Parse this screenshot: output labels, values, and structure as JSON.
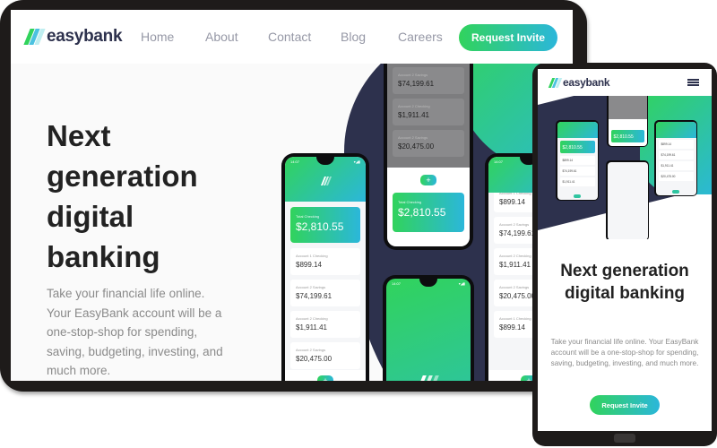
{
  "brand": {
    "name": "easybank",
    "colors": {
      "green": "#31d35c",
      "cyan": "#2bb7da",
      "navy": "#2d314d",
      "text_gray": "#9698a6"
    }
  },
  "desktop": {
    "nav": {
      "links": [
        "Home",
        "About",
        "Contact",
        "Blog",
        "Careers"
      ],
      "cta_label": "Request Invite"
    },
    "hero": {
      "title": "Next generation digital banking",
      "description": "Take your financial life online. Your EasyBank account will be a one-stop-shop for spending, saving, budgeting, investing, and much more."
    }
  },
  "mockup": {
    "status_time": "14:07",
    "status_icons": "▾◢▮",
    "total_label": "Total Checking",
    "total_amount": "$2,810.55",
    "accounts": [
      {
        "label": "Account 1 Checking",
        "amount": "$899.14"
      },
      {
        "label": "Account 2 Savings",
        "amount": "$74,199.61"
      },
      {
        "label": "Account 2 Checking",
        "amount": "$1,911.41"
      },
      {
        "label": "Account 2 Savings",
        "amount": "$20,475.00"
      },
      {
        "label": "Account 1 Checking",
        "amount": "$899.14"
      }
    ],
    "fab_icon": "plus-icon"
  },
  "mobile": {
    "menu_icon": "hamburger-icon",
    "hero": {
      "title": "Next generation digital banking",
      "description": "Take your financial life online. Your EasyBank account will be a one-stop-shop for spending, saving, budgeting, investing, and much more."
    },
    "cta_label": "Request Invite"
  }
}
